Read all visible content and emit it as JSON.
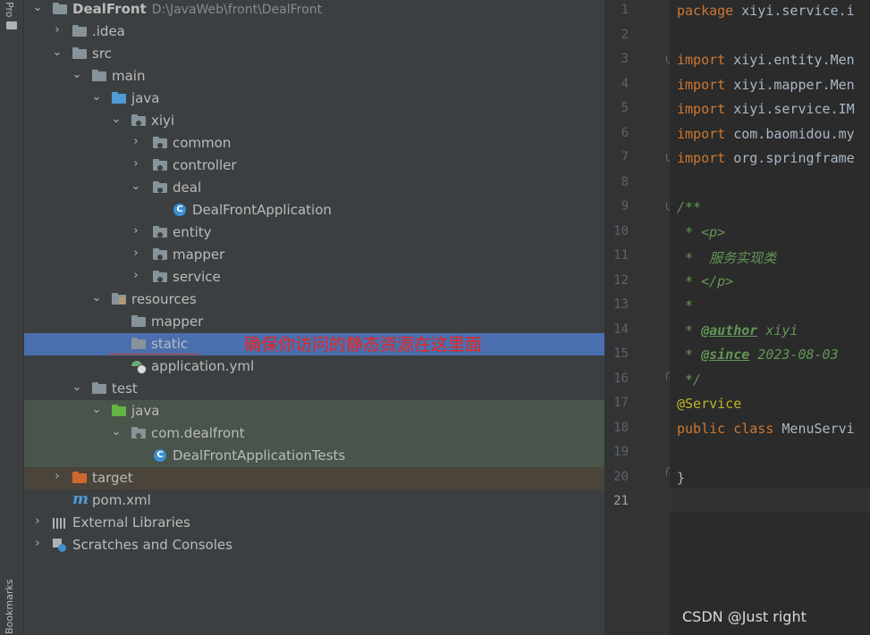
{
  "sidebar": {
    "project_tab": "Pro",
    "bookmarks_tab": "Bookmarks"
  },
  "tree": {
    "root_name": "DealFront",
    "root_path": "D:\\JavaWeb\\front\\DealFront",
    "idea": ".idea",
    "src": "src",
    "main": "main",
    "java": "java",
    "xiyi": "xiyi",
    "common": "common",
    "controller": "controller",
    "deal": "deal",
    "app_class": "DealFrontApplication",
    "entity": "entity",
    "mapper": "mapper",
    "service": "service",
    "resources": "resources",
    "res_mapper": "mapper",
    "static": "static",
    "application_yml": "application.yml",
    "test": "test",
    "test_java": "java",
    "com_dealfront": "com.dealfront",
    "test_class": "DealFrontApplicationTests",
    "target": "target",
    "pom": "pom.xml",
    "external_libraries": "External Libraries",
    "scratches": "Scratches and Consoles"
  },
  "annotation": {
    "text": "确保你访问的静态资源在这里面"
  },
  "editor": {
    "line_numbers": [
      "1",
      "2",
      "3",
      "4",
      "5",
      "6",
      "7",
      "8",
      "9",
      "10",
      "11",
      "12",
      "13",
      "14",
      "15",
      "16",
      "17",
      "18",
      "19",
      "20",
      "21"
    ],
    "current_line": "21",
    "lines": {
      "l1_kw": "package",
      "l1_rest": " xiyi.service.i",
      "l3_kw": "import",
      "l3_rest": " xiyi.entity.Men",
      "l4_kw": "import",
      "l4_rest": " xiyi.mapper.Men",
      "l5_kw": "import",
      "l5_rest": " xiyi.service.IM",
      "l6_kw": "import",
      "l6_rest": " com.baomidou.my",
      "l7_kw": "import",
      "l7_rest": " org.springframe",
      "l9": "/**",
      "l10_pre": " * ",
      "l10_tag": "<p>",
      "l11": " *  服务实现类",
      "l12_pre": " * ",
      "l12_tag": "</p>",
      "l13": " *",
      "l14_pre": " * ",
      "l14_tag": "@author",
      "l14_rest": " xiyi",
      "l15_pre": " * ",
      "l15_tag": "@since",
      "l15_rest": " 2023-08-03",
      "l16": " */",
      "l17": "@Service",
      "l18_kw": "public class",
      "l18_rest": " MenuServi",
      "l20": "}"
    }
  },
  "watermark": "CSDN @Just right"
}
